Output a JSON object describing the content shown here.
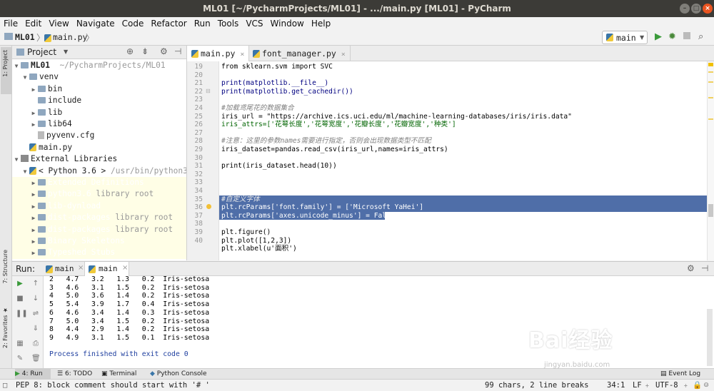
{
  "window": {
    "title": "ML01 [~/PycharmProjects/ML01] - .../main.py [ML01] - PyCharm"
  },
  "menu": [
    "File",
    "Edit",
    "View",
    "Navigate",
    "Code",
    "Refactor",
    "Run",
    "Tools",
    "VCS",
    "Window",
    "Help"
  ],
  "breadcrumb": {
    "project": "ML01",
    "file": "main.py"
  },
  "run_config": {
    "label": "main",
    "icon": "python-icon"
  },
  "project_panel": {
    "title": "Project",
    "root": {
      "name": "ML01",
      "path": "~/PycharmProjects/ML01"
    },
    "items": [
      {
        "label": "venv",
        "type": "folder"
      },
      {
        "label": "bin",
        "type": "folder"
      },
      {
        "label": "include",
        "type": "folder"
      },
      {
        "label": "lib",
        "type": "folder"
      },
      {
        "label": "lib64",
        "type": "folder"
      },
      {
        "label": "pyvenv.cfg",
        "type": "config"
      },
      {
        "label": "main.py",
        "type": "python"
      },
      {
        "label": "External Libraries",
        "type": "library"
      },
      {
        "label": "< Python 3.6 >",
        "hint": "/usr/bin/python3.",
        "type": "python"
      },
      {
        "label": "Extended Definitions",
        "type": "folder"
      },
      {
        "label": "python3.6",
        "hint": "library root",
        "type": "folder"
      },
      {
        "label": "lib-dynload",
        "type": "folder"
      },
      {
        "label": "dist-packages",
        "hint": "library root",
        "type": "folder"
      },
      {
        "label": "dist-packages",
        "hint": "library root",
        "type": "folder"
      },
      {
        "label": "Binary Skeletons",
        "type": "folder"
      },
      {
        "label": "Typeshed Stubs",
        "type": "folder"
      }
    ]
  },
  "editor": {
    "tabs": [
      {
        "label": "main.py",
        "active": true
      },
      {
        "label": "font_manager.py",
        "active": false
      }
    ],
    "line_numbers": [
      "19",
      "20",
      "21",
      "22",
      "23",
      "24",
      "25",
      "26",
      "27",
      "28",
      "29",
      "30",
      "31",
      "32",
      "33",
      "34",
      "35",
      "36",
      "37",
      "38",
      "39",
      "40"
    ],
    "code": [
      "from sklearn.svm import SVC",
      "",
      "print(matplotlib.__file__)",
      "print(matplotlib.get_cachedir())",
      "",
      "#加载鸢尾花的数据集合",
      "iris_url = \"https://archive.ics.uci.edu/ml/machine-learning-databases/iris/iris.data\"",
      "iris_attrs=['花萼长度','花萼宽度','花瓣长度','花瓣宽度','种类']",
      "",
      "#注意：这里的参数names需要进行指定，否则会出现数据类型不匹配",
      "iris_dataset=pandas.read_csv(iris_url,names=iris_attrs)",
      "",
      "print(iris_dataset.head(10))",
      "",
      "",
      "#自定义字体",
      "plt.rcParams['font.family'] = ['Microsoft YaHei']",
      "plt.rcParams['axes.unicode_minus'] = False",
      "",
      "plt.figure()",
      "plt.plot([1,2,3])",
      "plt.xlabel(u'面积')"
    ]
  },
  "run_panel": {
    "label": "Run:",
    "tabs": [
      "main",
      "main"
    ],
    "output": [
      "2   4.7   3.2   1.3   0.2  Iris-setosa",
      "3   4.6   3.1   1.5   0.2  Iris-setosa",
      "4   5.0   3.6   1.4   0.2  Iris-setosa",
      "5   5.4   3.9   1.7   0.4  Iris-setosa",
      "6   4.6   3.4   1.4   0.3  Iris-setosa",
      "7   5.0   3.4   1.5   0.2  Iris-setosa",
      "8   4.4   2.9   1.4   0.2  Iris-setosa",
      "9   4.9   3.1   1.5   0.1  Iris-setosa"
    ],
    "exit_message": "Process finished with exit code 0"
  },
  "tool_windows": [
    "4: Run",
    "6: TODO",
    "Terminal",
    "Python Console",
    "Event Log"
  ],
  "status": {
    "message": "PEP 8: block comment should start with '# '",
    "chars": "99 chars, 2 line breaks",
    "position": "34:1",
    "line_sep": "LF",
    "encoding": "UTF-8"
  },
  "watermark": {
    "main": "Bai经验",
    "sub": "jingyan.baidu.com"
  },
  "colors": {
    "selection": "#4f6ea8",
    "keyword": "#000080",
    "string": "#008000",
    "comment": "#808080"
  }
}
